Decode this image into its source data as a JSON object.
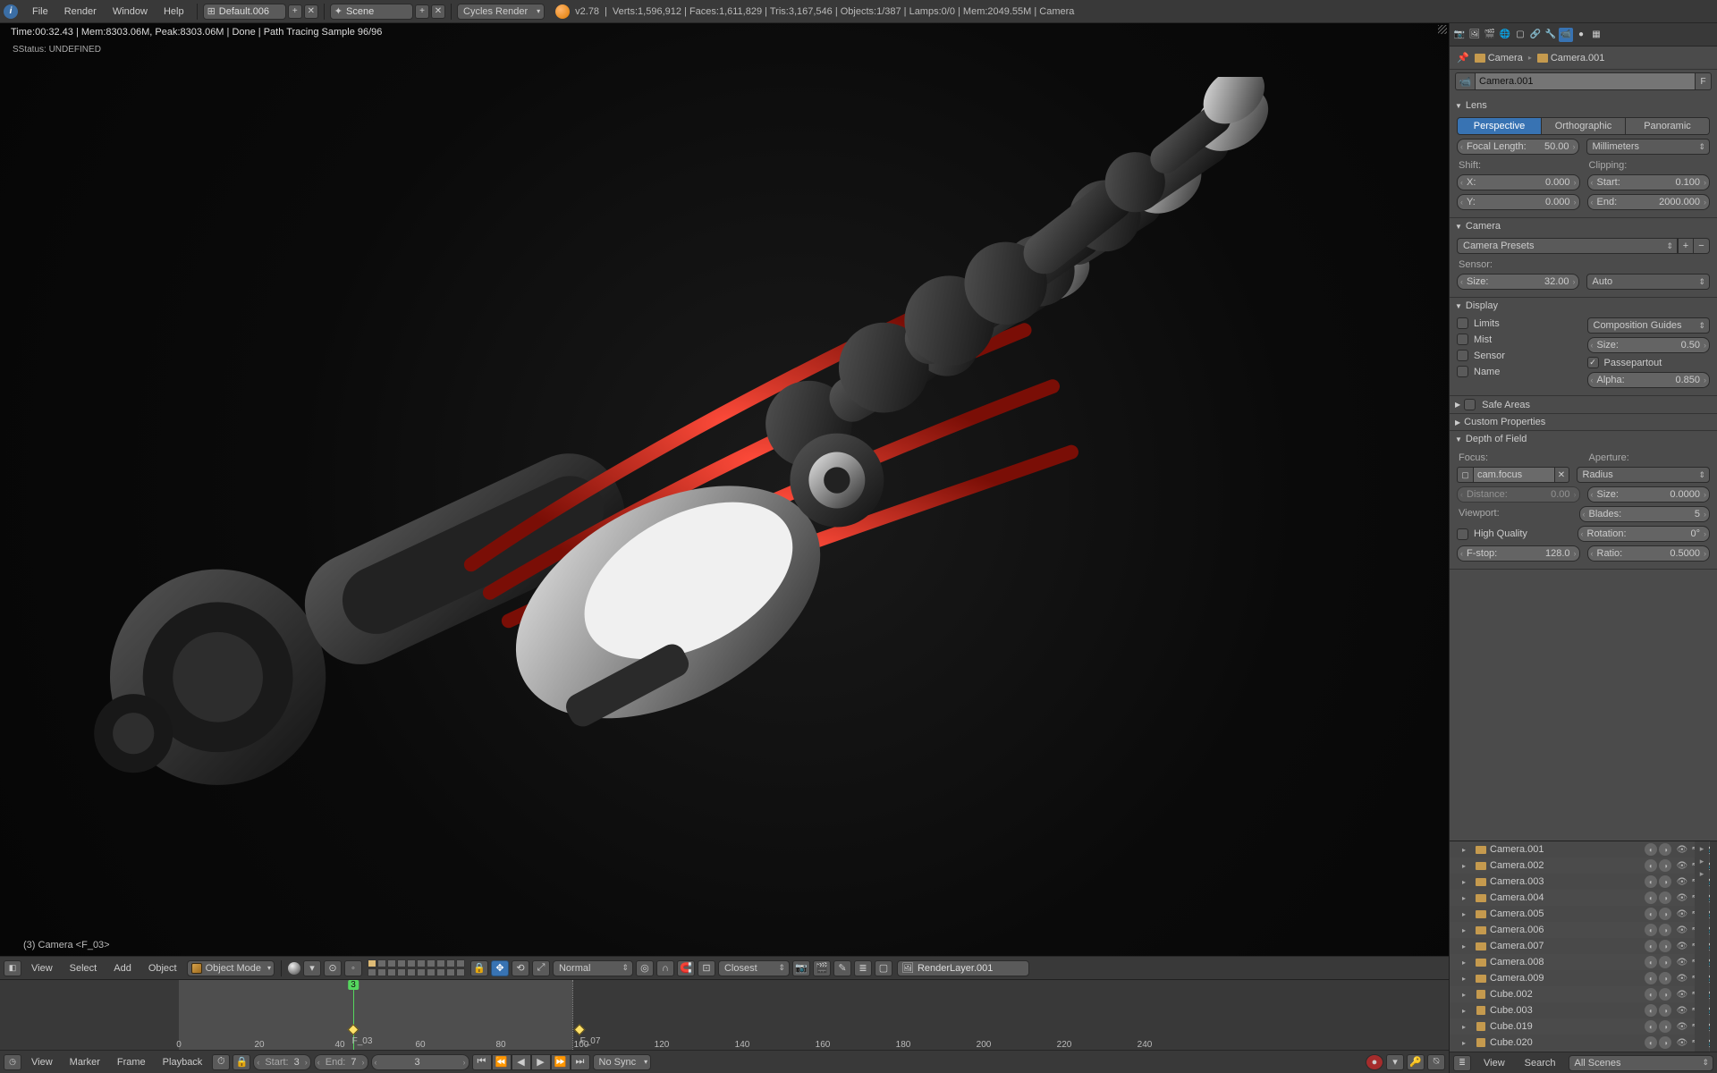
{
  "topbar": {
    "menus": [
      "File",
      "Render",
      "Window",
      "Help"
    ],
    "layout_field_icon": "⊞",
    "layout_name": "Default.006",
    "scene_icon": "✦",
    "scene_name": "Scene",
    "engine": "Cycles Render",
    "version": "v2.78",
    "stats": "Verts:1,596,912 | Faces:1,611,829 | Tris:3,167,546 | Objects:1/387 | Lamps:0/0 | Mem:2049.55M | Camera"
  },
  "viewport": {
    "top_stats": "Time:00:32.43 | Mem:8303.06M, Peak:8303.06M | Done | Path Tracing Sample 96/96",
    "sub_stats": "SStatus: UNDEFINED",
    "camera_label": "(3) Camera <F_03>",
    "header": {
      "menus": [
        "View",
        "Select",
        "Add",
        "Object"
      ],
      "mode": "Object Mode",
      "normal": "Normal",
      "snap_target": "Closest",
      "render_layer": "RenderLayer.001"
    }
  },
  "timeline": {
    "ticks": [
      0,
      20,
      40,
      60,
      80,
      100,
      120,
      140,
      160,
      180,
      200,
      220,
      240
    ],
    "range_start": 3,
    "range_end": 7,
    "playhead": 3,
    "keys": [
      {
        "frame": 3,
        "label": "F_03"
      },
      {
        "frame": 7,
        "label": "F_07"
      }
    ],
    "header": {
      "menus": [
        "View",
        "Marker",
        "Frame",
        "Playback"
      ],
      "start_label": "Start:",
      "start_value": "3",
      "end_label": "End:",
      "end_value": "7",
      "current_value": "3",
      "sync": "No Sync"
    }
  },
  "properties": {
    "breadcrumb_parent": "Camera",
    "breadcrumb_child": "Camera.001",
    "datablock_name": "Camera.001",
    "lens": {
      "title": "Lens",
      "tabs": [
        "Perspective",
        "Orthographic",
        "Panoramic"
      ],
      "focal_label": "Focal Length:",
      "focal_value": "50.00",
      "unit": "Millimeters",
      "shift_label": "Shift:",
      "shift_x_label": "X:",
      "shift_x": "0.000",
      "shift_y_label": "Y:",
      "shift_y": "0.000",
      "clip_label": "Clipping:",
      "clip_start_label": "Start:",
      "clip_start": "0.100",
      "clip_end_label": "End:",
      "clip_end": "2000.000"
    },
    "camera": {
      "title": "Camera",
      "presets": "Camera Presets",
      "sensor_label": "Sensor:",
      "size_label": "Size:",
      "size_value": "32.00",
      "fit": "Auto"
    },
    "display": {
      "title": "Display",
      "limits": "Limits",
      "mist": "Mist",
      "sensor": "Sensor",
      "name": "Name",
      "comp_guides": "Composition Guides",
      "size_label": "Size:",
      "size_value": "0.50",
      "passepartout": "Passepartout",
      "alpha_label": "Alpha:",
      "alpha_value": "0.850"
    },
    "safe_areas": {
      "title": "Safe Areas"
    },
    "custom_props": {
      "title": "Custom Properties"
    },
    "dof": {
      "title": "Depth of Field",
      "focus_label": "Focus:",
      "focus_object": "cam.focus",
      "distance_label": "Distance:",
      "distance_value": "0.00",
      "viewport_label": "Viewport:",
      "hq": "High Quality",
      "fstop_label": "F-stop:",
      "fstop_value": "128.0",
      "aperture_label": "Aperture:",
      "aperture_type": "Radius",
      "ap_size_label": "Size:",
      "ap_size_value": "0.0000",
      "blades_label": "Blades:",
      "blades_value": "5",
      "rotation_label": "Rotation:",
      "rotation_value": "0°",
      "ratio_label": "Ratio:",
      "ratio_value": "0.5000"
    }
  },
  "outliner": {
    "items": [
      {
        "name": "Camera.001",
        "type": "camera"
      },
      {
        "name": "Camera.002",
        "type": "camera"
      },
      {
        "name": "Camera.003",
        "type": "camera"
      },
      {
        "name": "Camera.004",
        "type": "camera"
      },
      {
        "name": "Camera.005",
        "type": "camera"
      },
      {
        "name": "Camera.006",
        "type": "camera"
      },
      {
        "name": "Camera.007",
        "type": "camera"
      },
      {
        "name": "Camera.008",
        "type": "camera"
      },
      {
        "name": "Camera.009",
        "type": "camera"
      },
      {
        "name": "Cube.002",
        "type": "cube"
      },
      {
        "name": "Cube.003",
        "type": "cube"
      },
      {
        "name": "Cube.019",
        "type": "cube"
      },
      {
        "name": "Cube.020",
        "type": "cube"
      }
    ],
    "header": {
      "menus": [
        "View",
        "Search"
      ],
      "scope": "All Scenes"
    }
  }
}
